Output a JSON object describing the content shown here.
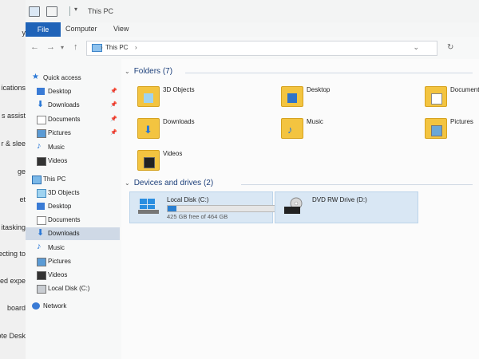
{
  "background_app": {
    "items": [
      "y",
      "ications",
      "s assist",
      "r & slee",
      "ge",
      "et",
      "itasking",
      "ecting to",
      "red expe",
      "board",
      "mote Desk"
    ]
  },
  "window": {
    "title": "This PC",
    "ribbon_tabs": [
      "File",
      "Computer",
      "View"
    ]
  },
  "address": {
    "crumb": "This PC",
    "chevron": "›",
    "dropdown": "⌄",
    "refresh": "↻"
  },
  "nav": {
    "quick_access": "Quick access",
    "quick_items": [
      {
        "label": "Desktop",
        "icon": "desktop-icon"
      },
      {
        "label": "Downloads",
        "icon": "downloads-icon"
      },
      {
        "label": "Documents",
        "icon": "documents-icon"
      },
      {
        "label": "Pictures",
        "icon": "pictures-icon"
      },
      {
        "label": "Music",
        "icon": "music-icon"
      },
      {
        "label": "Videos",
        "icon": "videos-icon"
      }
    ],
    "this_pc": "This PC",
    "pc_items": [
      {
        "label": "3D Objects",
        "icon": "3d-objects-icon"
      },
      {
        "label": "Desktop",
        "icon": "desktop-icon"
      },
      {
        "label": "Documents",
        "icon": "documents-icon"
      },
      {
        "label": "Downloads",
        "icon": "downloads-icon"
      },
      {
        "label": "Music",
        "icon": "music-icon"
      },
      {
        "label": "Pictures",
        "icon": "pictures-icon"
      },
      {
        "label": "Videos",
        "icon": "videos-icon"
      },
      {
        "label": "Local Disk (C:)",
        "icon": "drive-icon"
      }
    ],
    "selected": "Downloads",
    "network": "Network"
  },
  "content": {
    "folders_header": "Folders (7)",
    "folders": [
      "3D Objects",
      "Desktop",
      "Documents",
      "Downloads",
      "Music",
      "Pictures",
      "Videos"
    ],
    "devices_header": "Devices and drives (2)",
    "drives": [
      {
        "name": "Local Disk (C:)",
        "free": "425 GB free of 464 GB",
        "used_fraction": 0.084
      },
      {
        "name": "DVD RW Drive (D:)"
      }
    ]
  },
  "colors": {
    "accent": "#1f63b8",
    "selection": "#cfd9e6",
    "drive_fill": "#2b7fd0"
  }
}
